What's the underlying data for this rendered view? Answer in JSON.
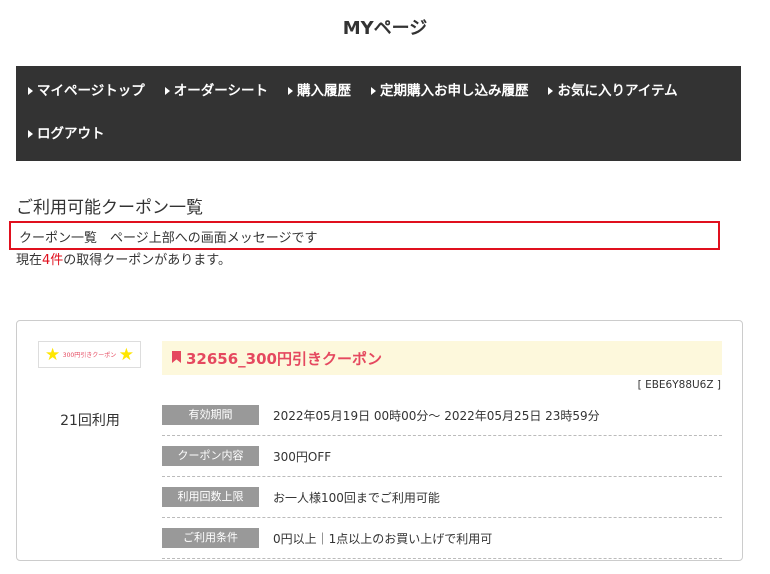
{
  "title": "MYページ",
  "nav": [
    "マイページトップ",
    "オーダーシート",
    "購入履歴",
    "定期購入お申し込み履歴",
    "お気に入りアイテム",
    "ログアウト"
  ],
  "heading": "ご利用可能クーポン一覧",
  "message": "クーポン一覧　ページ上部への画面メッセージです",
  "count": {
    "prefix": "現在",
    "num": "4件",
    "suffix": "の取得クーポンがあります。"
  },
  "coupon": {
    "image_text": "300円引きクーポン",
    "uses": "21回利用",
    "name": "32656_300円引きクーポン",
    "code": "[ EBE6Y88U6Z ]",
    "rows": [
      {
        "label": "有効期間",
        "value": "2022年05月19日 00時00分～ 2022年05月25日 23時59分"
      },
      {
        "label": "クーポン内容",
        "value": "300円OFF"
      },
      {
        "label": "利用回数上限",
        "value": "お一人様100回までご利用可能"
      },
      {
        "label": "ご利用条件",
        "value": "0円以上｜1点以上のお買い上げで利用可"
      }
    ]
  }
}
